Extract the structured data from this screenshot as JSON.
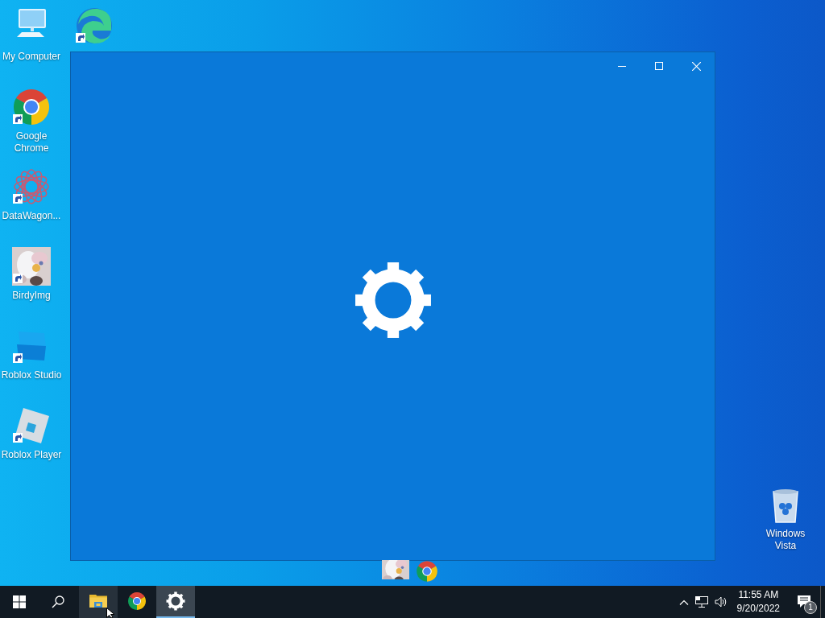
{
  "desktop_icons": [
    {
      "kind": "computer",
      "label": "My Computer",
      "shortcut": false
    },
    {
      "kind": "chrome",
      "label": "Google Chrome",
      "shortcut": true
    },
    {
      "kind": "mandala",
      "label": "DataWagon...",
      "shortcut": true
    },
    {
      "kind": "picture",
      "label": "BirdyImg",
      "shortcut": true
    },
    {
      "kind": "studio",
      "label": "Roblox Studio",
      "shortcut": true
    },
    {
      "kind": "player",
      "label": "Roblox Player",
      "shortcut": true
    }
  ],
  "covered_icon": {
    "kind": "edge",
    "shortcut": true
  },
  "recycle_bin": {
    "kind": "bin",
    "label": "Windows Vista"
  },
  "window": {
    "kind": "gear"
  },
  "floating_items": [
    {
      "kind": "picture"
    },
    {
      "kind": "chrome"
    }
  ],
  "taskbar": {
    "apps": [
      {
        "kind": "explorer",
        "selected": false,
        "hovered": true
      },
      {
        "kind": "chrome",
        "selected": false,
        "hovered": false
      },
      {
        "kind": "gear",
        "selected": true,
        "hovered": false
      }
    ],
    "time": "11:55 AM",
    "date": "9/20/2022",
    "notification_count": "1"
  }
}
